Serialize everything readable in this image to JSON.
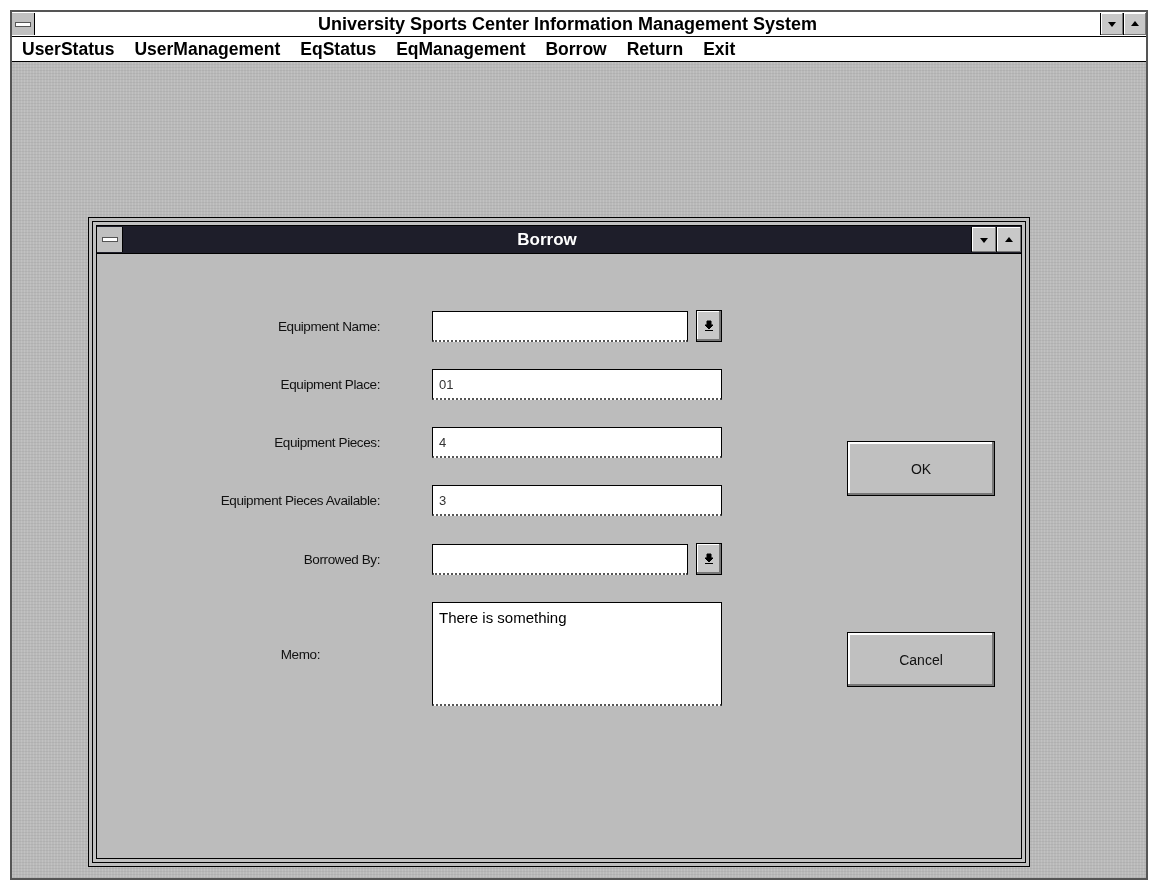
{
  "window": {
    "title": "University Sports Center Information Management System"
  },
  "menu": [
    {
      "label": "UserStatus"
    },
    {
      "label": "UserManagement"
    },
    {
      "label": "EqStatus"
    },
    {
      "label": "EqManagement"
    },
    {
      "label": "Borrow"
    },
    {
      "label": "Return"
    },
    {
      "label": "Exit"
    }
  ],
  "dialog": {
    "title": "Borrow",
    "fields": [
      {
        "kind": "combo",
        "label": "Equipment Name:"
      },
      {
        "kind": "text",
        "label": "Equipment Place:",
        "value": "01"
      },
      {
        "kind": "text",
        "label": "Equipment Pieces:",
        "value": "4"
      },
      {
        "kind": "text",
        "label": "Equipment Pieces Available:",
        "value": "3"
      },
      {
        "kind": "combo",
        "label": "Borrowed By:"
      },
      {
        "kind": "memo",
        "label": "Memo:",
        "value": "There is something"
      }
    ],
    "buttons": [
      {
        "label": "OK"
      },
      {
        "label": "Cancel"
      }
    ]
  }
}
